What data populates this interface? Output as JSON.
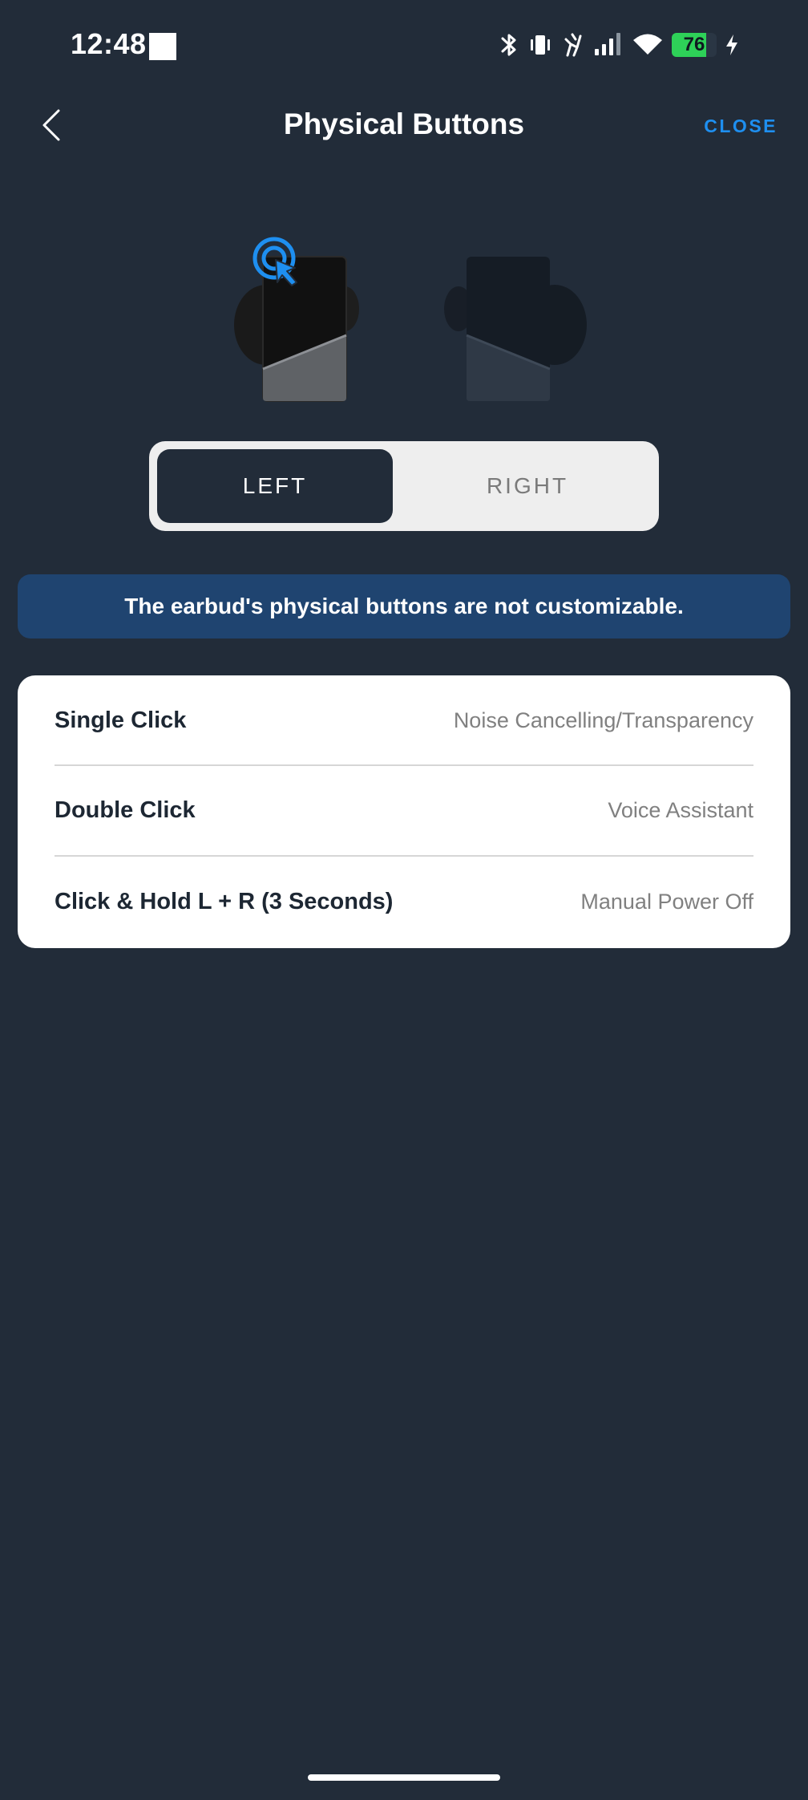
{
  "status_bar": {
    "time": "12:48",
    "battery_level": 76,
    "icons": [
      "bluetooth-icon",
      "vibrate-icon",
      "signal-icon",
      "wifi-icon",
      "battery-icon",
      "charging-icon"
    ]
  },
  "header": {
    "title": "Physical Buttons",
    "close_label": "CLOSE",
    "back_icon": "chevron-left-icon"
  },
  "earbud_selector": {
    "options": [
      "LEFT",
      "RIGHT"
    ],
    "selected": "LEFT"
  },
  "info_banner": {
    "text": "The earbud's physical buttons are not customizable."
  },
  "controls": [
    {
      "label": "Single Click",
      "value": "Noise Cancelling/Transparency"
    },
    {
      "label": "Double Click",
      "value": "Voice Assistant"
    },
    {
      "label": "Click & Hold L + R (3 Seconds)",
      "value": "Manual Power Off"
    }
  ],
  "colors": {
    "background": "#222c39",
    "accent": "#1e8ff0",
    "banner": "#1f4470",
    "battery": "#2ed158"
  }
}
